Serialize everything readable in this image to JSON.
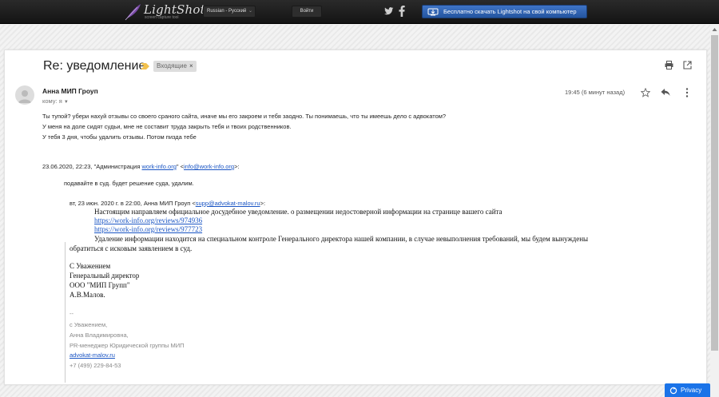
{
  "topbar": {
    "logo_title": "LightShot",
    "logo_subtitle": "screen capture tool",
    "language": "Russian - Русский",
    "login_label": "Войти",
    "download_label": "Бесплатно скачать Lightshot на свой компьютер"
  },
  "mail": {
    "subject": "Re: уведомление",
    "label": "Входящие",
    "label_close": "×",
    "sender": "Анна МИП Гроуп",
    "to": "кому: я",
    "time": "19:45 (6 минут назад)",
    "body": [
      "Ты тупой? убери нахуй отзывы со своего сраного сайта, иначе мы его закроем и тебя заодно. Ты понимаешь, что ты имеешь дело с адвокатом?",
      "У меня на доле сидят судьи, мне не составит труда закрыть тебя и твоих родственников.",
      "У тебя 3 дня, чтобы удалить отзывы. Потом пизда тебе"
    ],
    "quote1": {
      "header_prefix": "23.06.2020, 22:23, \"Администрация ",
      "header_site": "work-info.org",
      "header_mid": "\" <",
      "header_email": "info@work-info.org",
      "header_suffix": ">:",
      "text": "подавайте в суд. будет решение суда, удалим."
    },
    "quote2": {
      "header_prefix": "вт, 23 июн. 2020 г. в 22:00, Анна МИП Гроуп <",
      "header_email": "supp@advokat-malov.ru",
      "header_suffix": ">:",
      "line1": "Настоящим направляем официальное досудебное уведомление. о размещении недостоверной информации на странице вашего сайта",
      "link1": "https://work-info.org/reviews/974936",
      "link2": "https://work-info.org/reviews/977723",
      "line2": "Удаление информации находится на специальном контроле Генерального директора нашей компании, в случае невыполнения требований, мы будем вынуждены",
      "line3": "обратиться с исковым заявлением в суд.",
      "sig": [
        "С Уважением",
        "Генеральный директор",
        "ООО \"МИП Групп\"",
        "А.В.Малов."
      ],
      "grey_sig": [
        "--",
        "с Уважением,",
        "Анна Владимировна,",
        "PR-менеджер Юридической группы МИП"
      ],
      "site": "advokat-malov.ru",
      "phone": "+7 (499) 229-84-53"
    }
  },
  "privacy_label": "Privacy",
  "colors": {
    "accent": "#1a73e8",
    "download": "#2f63b3",
    "link": "#1a55c4",
    "importance": "#f2c14e"
  }
}
